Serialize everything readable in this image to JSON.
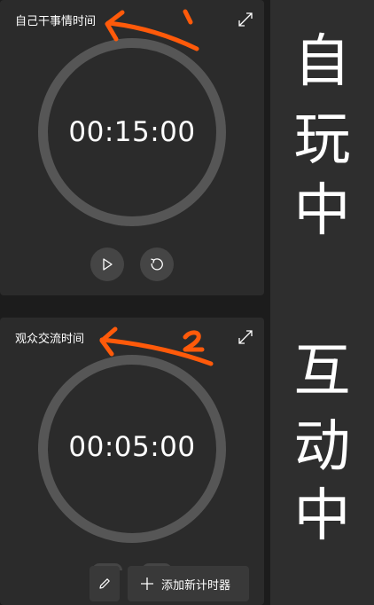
{
  "timers": [
    {
      "title": "自己干事情时间",
      "time": "00:15:00"
    },
    {
      "title": "观众交流时间",
      "time": "00:05:00"
    }
  ],
  "footer": {
    "add_label": "添加新计时器"
  },
  "side_text": {
    "top": [
      "自",
      "玩",
      "中"
    ],
    "bottom": [
      "互",
      "动",
      "中"
    ]
  },
  "annotations": {
    "mark_1": "1",
    "mark_2": "2",
    "color": "#ff5a0a"
  },
  "colors": {
    "card": "#2b2b2b",
    "ring": "#565656",
    "button": "#454545",
    "background": "#1c1c1c"
  },
  "icons": [
    "expand-icon",
    "play-icon",
    "reset-icon",
    "edit-icon",
    "plus-icon"
  ]
}
